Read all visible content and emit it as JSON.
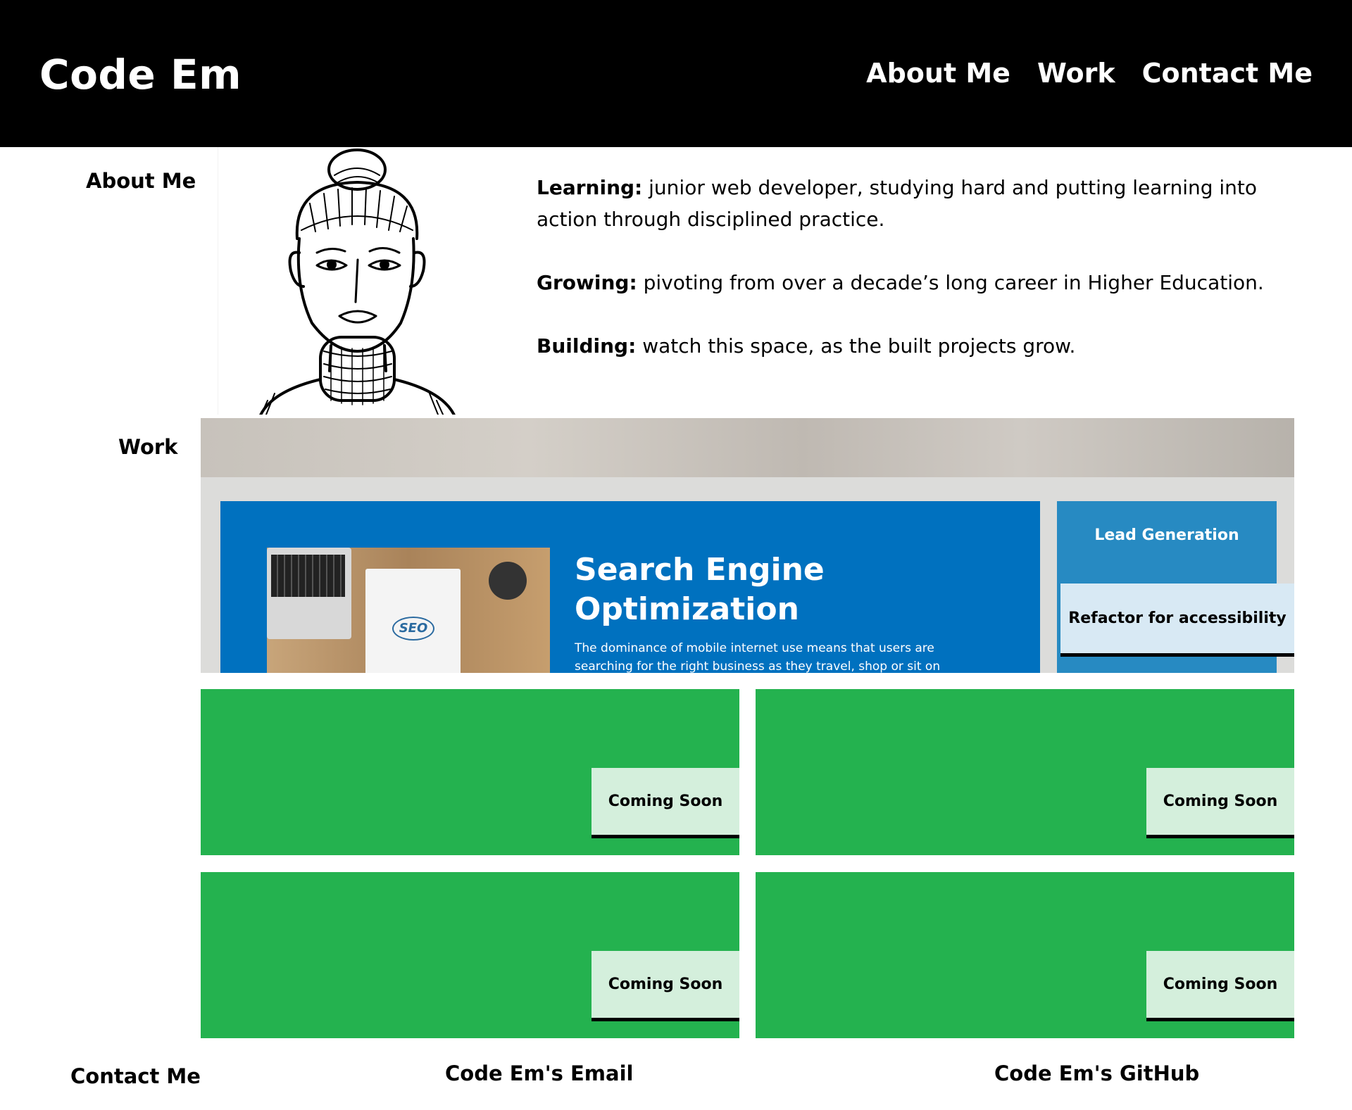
{
  "header": {
    "logo": "Code Em",
    "nav": [
      "About Me",
      "Work",
      "Contact Me"
    ]
  },
  "about": {
    "label": "About Me",
    "avatar_icon": "woman-line-drawing-icon",
    "items": [
      {
        "term": "Learning:",
        "text": " junior web developer, studying hard and putting learning into action through disciplined practice."
      },
      {
        "term": "Growing:",
        "text": " pivoting from over a decade’s long career in Higher Education."
      },
      {
        "term": "Building:",
        "text": " watch this space, as the built projects grow."
      }
    ]
  },
  "work": {
    "label": "Work",
    "feature": {
      "heading_line1": "Search Engine",
      "heading_line2": "Optimization",
      "body": "The dominance of mobile internet use means that users are searching for the right business as they travel, shop or sit on their",
      "side_title": "Lead Generation",
      "photo_badge": "SEO",
      "button": "Refactor for accessibility"
    },
    "cards": [
      "Coming Soon",
      "Coming Soon",
      "Coming Soon",
      "Coming Soon"
    ],
    "colors": {
      "card": "#24b24f",
      "card_button": "#d4efdc",
      "feature": "#0071bf"
    }
  },
  "contact": {
    "label": "Contact Me",
    "email": "Code Em's Email",
    "github": "Code Em's GitHub"
  }
}
